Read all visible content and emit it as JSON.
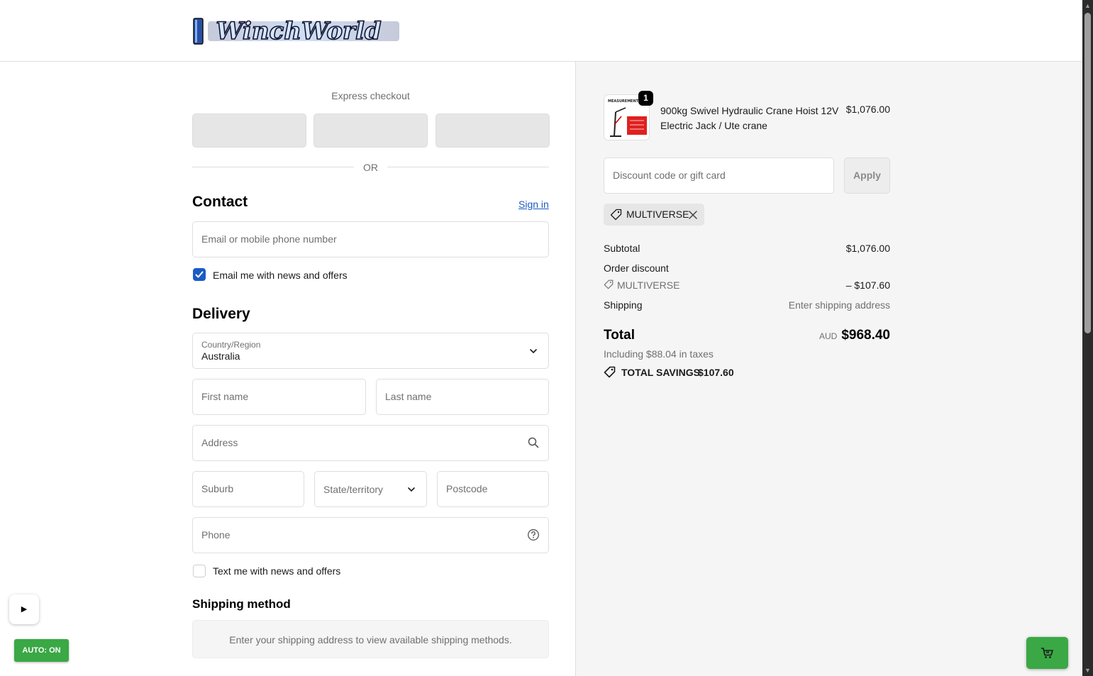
{
  "colors": {
    "accent": "#1a5bc4",
    "green": "#3aa845",
    "muted": "#707070",
    "border": "#dedede"
  },
  "header": {
    "logo_text": "WinchWorld"
  },
  "express": {
    "title": "Express checkout",
    "or": "OR"
  },
  "contact": {
    "heading": "Contact",
    "sign_in": "Sign in",
    "email_placeholder": "Email or mobile phone number",
    "news_checkbox_label": "Email me with news and offers",
    "news_checked": true
  },
  "delivery": {
    "heading": "Delivery",
    "country_label": "Country/Region",
    "country_value": "Australia",
    "first_name_placeholder": "First name",
    "last_name_placeholder": "Last name",
    "address_placeholder": "Address",
    "suburb_placeholder": "Suburb",
    "state_placeholder": "State/territory",
    "postcode_placeholder": "Postcode",
    "phone_placeholder": "Phone",
    "sms_checkbox_label": "Text me with news and offers",
    "sms_checked": false
  },
  "shipping_method": {
    "heading": "Shipping method",
    "notice": "Enter your shipping address to view available shipping methods."
  },
  "order": {
    "item": {
      "quantity": "1",
      "name_line1": "900kg Swivel Hydraulic Crane Hoist 12V",
      "name_line2": "Electric Jack / Ute crane",
      "price": "$1,076.00",
      "image_caption": "MEASUREMENT"
    },
    "discount_placeholder": "Discount code or gift card",
    "apply_label": "Apply",
    "applied_code": "MULTIVERSE",
    "subtotal_label": "Subtotal",
    "subtotal_value": "$1,076.00",
    "order_discount_label": "Order discount",
    "discount_code": "MULTIVERSE",
    "discount_value": "– $107.60",
    "shipping_label": "Shipping",
    "shipping_value": "Enter shipping address",
    "total_label": "Total",
    "currency": "AUD",
    "total_value": "$968.40",
    "taxes_note": "Including $88.04 in taxes",
    "savings_label": "TOTAL SAVINGS",
    "savings_value": "$107.60"
  },
  "overlay": {
    "play_glyph": "▶",
    "auto_label": "AUTO: ON"
  }
}
